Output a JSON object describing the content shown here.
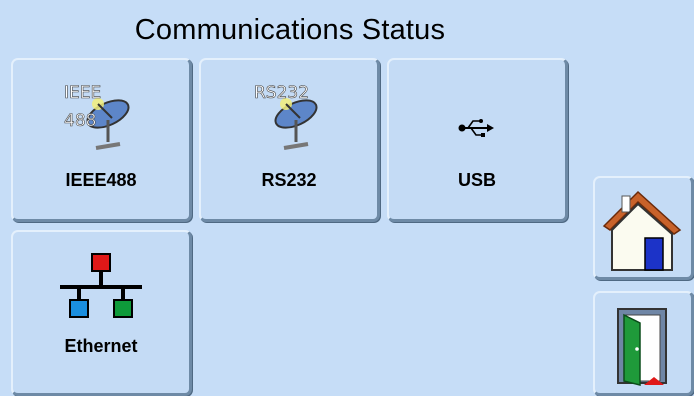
{
  "header": {
    "title": "Communications Status"
  },
  "tiles": [
    {
      "label": "IEEE488",
      "icon_text_top": "IEEE",
      "icon_text_bottom": "488",
      "icon": "satellite-dish-icon"
    },
    {
      "label": "RS232",
      "icon_text_top": "RS232",
      "icon": "satellite-dish-icon"
    },
    {
      "label": "USB",
      "icon": "usb-icon"
    },
    {
      "label": "Ethernet",
      "icon": "network-icon"
    }
  ],
  "nav": {
    "home_icon": "home-icon",
    "exit_icon": "exit-door-icon"
  },
  "colors": {
    "background": "#c6ddf7",
    "net_red": "#e01818",
    "net_blue": "#1a8fe0",
    "net_green": "#0e9a3a"
  }
}
